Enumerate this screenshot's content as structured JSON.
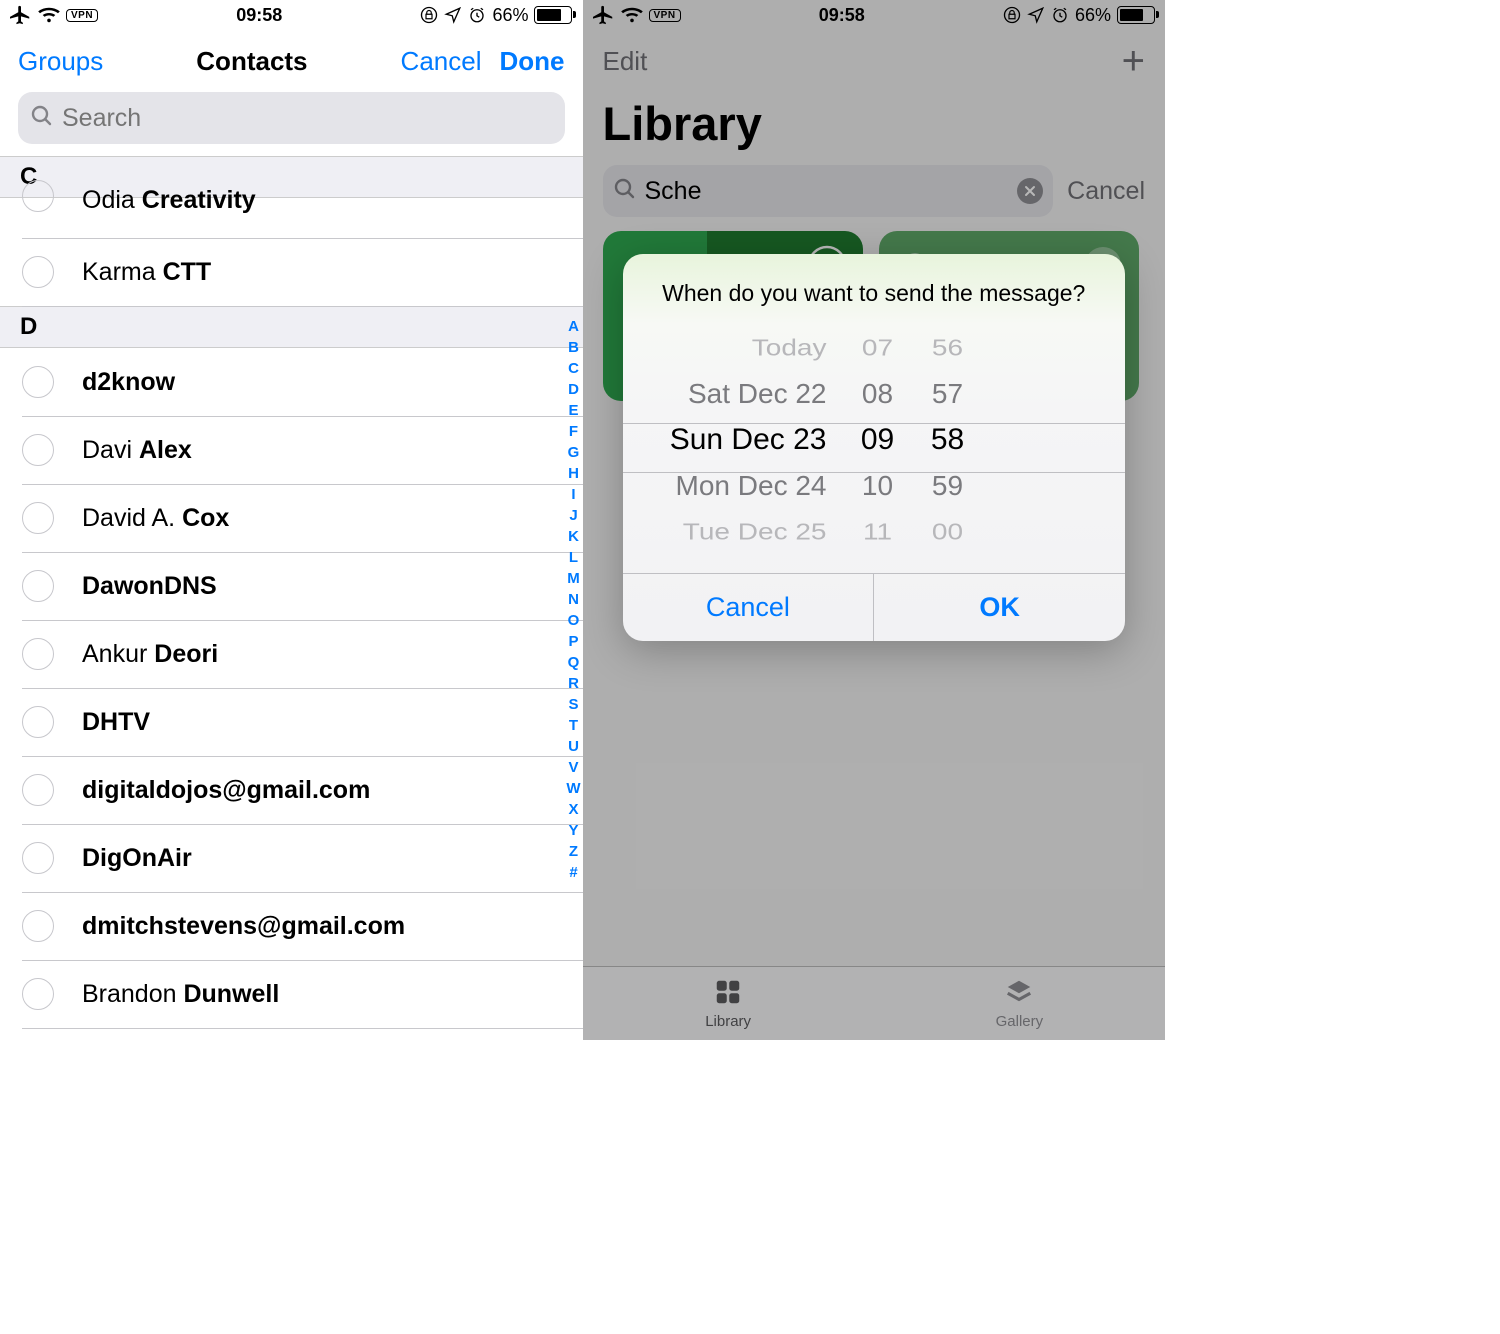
{
  "status": {
    "time": "09:58",
    "battery_pct": "66%",
    "vpn": "VPN"
  },
  "left": {
    "nav": {
      "groups": "Groups",
      "title": "Contacts",
      "cancel": "Cancel",
      "done": "Done"
    },
    "search": {
      "placeholder": "Search"
    },
    "sections": {
      "c": "C",
      "c_items": [
        {
          "first": "Odia ",
          "last": "Creativity"
        },
        {
          "first": "Karma ",
          "last": "CTT"
        }
      ],
      "d": "D",
      "d_items": [
        {
          "first": "",
          "last": "d2know"
        },
        {
          "first": "Davi ",
          "last": "Alex"
        },
        {
          "first": "David A. ",
          "last": "Cox"
        },
        {
          "first": "",
          "last": "DawonDNS"
        },
        {
          "first": "Ankur ",
          "last": "Deori"
        },
        {
          "first": "",
          "last": "DHTV"
        },
        {
          "first": "",
          "last": "digitaldojos@gmail.com"
        },
        {
          "first": "",
          "last": "DigOnAir"
        },
        {
          "first": "",
          "last": "dmitchstevens@gmail.com"
        },
        {
          "first": "Brandon ",
          "last": "Dunwell"
        }
      ]
    },
    "index": [
      "A",
      "B",
      "C",
      "D",
      "E",
      "F",
      "G",
      "H",
      "I",
      "J",
      "K",
      "L",
      "M",
      "N",
      "O",
      "P",
      "Q",
      "R",
      "S",
      "T",
      "U",
      "V",
      "W",
      "X",
      "Y",
      "Z",
      "#"
    ]
  },
  "right": {
    "nav": {
      "edit": "Edit"
    },
    "title": "Library",
    "search": {
      "text": "Sche",
      "cancel": "Cancel"
    },
    "dialog": {
      "title": "When do you want to send the message?",
      "rows": [
        {
          "date": "Today",
          "h": "07",
          "m": "56"
        },
        {
          "date": "Sat Dec 22",
          "h": "08",
          "m": "57"
        },
        {
          "date": "Sun Dec 23",
          "h": "09",
          "m": "58"
        },
        {
          "date": "Mon Dec 24",
          "h": "10",
          "m": "59"
        },
        {
          "date": "Tue Dec 25",
          "h": "11",
          "m": "00"
        }
      ],
      "cancel": "Cancel",
      "ok": "OK"
    },
    "tabs": {
      "library": "Library",
      "gallery": "Gallery"
    }
  }
}
